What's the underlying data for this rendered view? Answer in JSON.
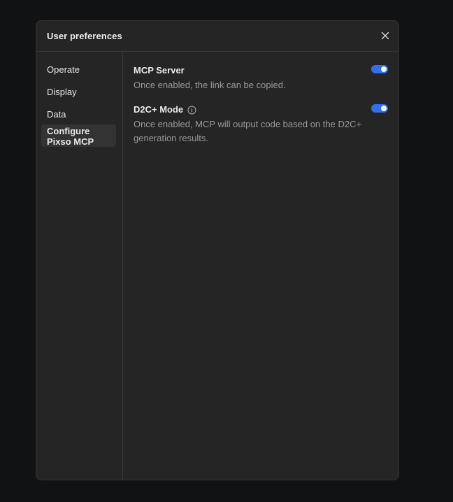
{
  "dialog": {
    "title": "User preferences",
    "close_icon": "close-icon"
  },
  "sidebar": {
    "items": [
      {
        "label": "Operate",
        "active": false
      },
      {
        "label": "Display",
        "active": false
      },
      {
        "label": "Data",
        "active": false
      },
      {
        "label": "Configure Pixso MCP",
        "active": true
      }
    ]
  },
  "settings": [
    {
      "title": "MCP Server",
      "description": "Once enabled, the link can be copied.",
      "enabled": true,
      "has_info_icon": false
    },
    {
      "title": "D2C+ Mode",
      "description": "Once enabled, MCP will output code based on the D2C+ generation results.",
      "enabled": true,
      "has_info_icon": true,
      "info_icon": "info-icon"
    }
  ],
  "colors": {
    "background": "#111214",
    "dialog": "#252525",
    "accent": "#2f6ff2",
    "text_primary": "#ececec",
    "text_secondary": "#9a9a9a"
  }
}
